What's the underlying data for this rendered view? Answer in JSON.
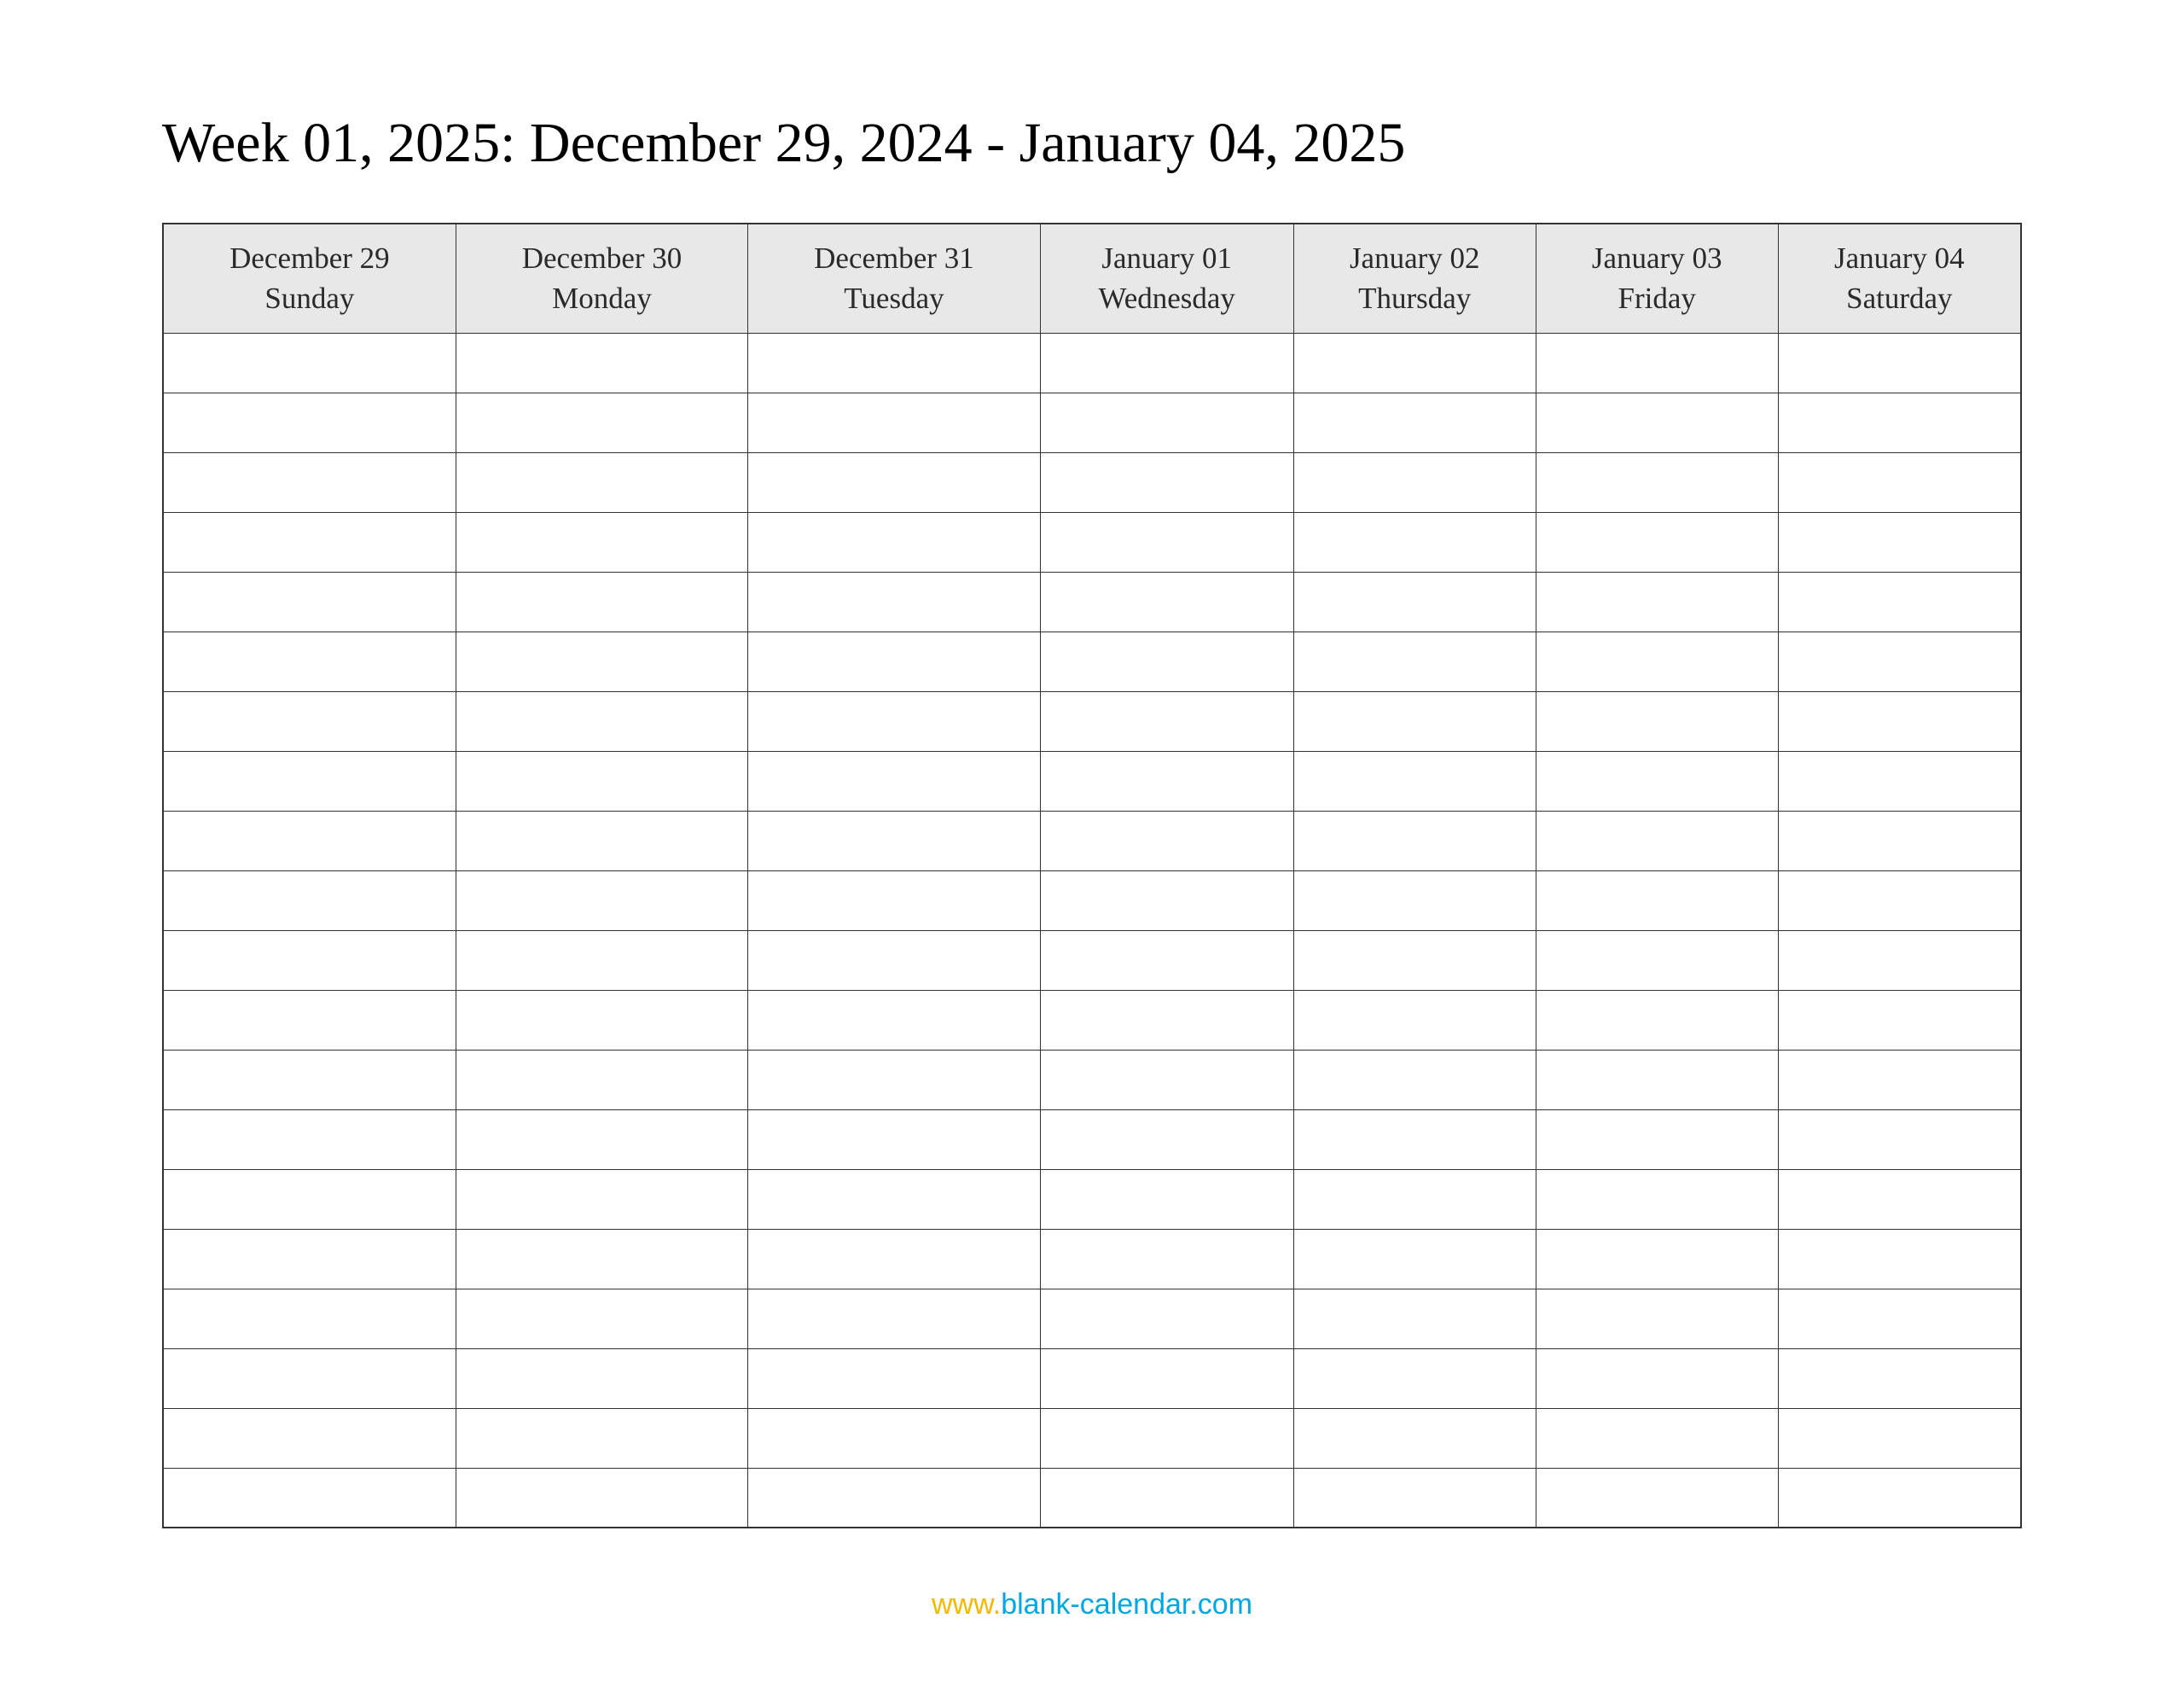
{
  "title": "Week 01, 2025: December 29, 2024 - January 04, 2025",
  "columns": [
    {
      "date": "December 29",
      "day": "Sunday"
    },
    {
      "date": "December 30",
      "day": "Monday"
    },
    {
      "date": "December 31",
      "day": "Tuesday"
    },
    {
      "date": "January 01",
      "day": "Wednesday"
    },
    {
      "date": "January 02",
      "day": "Thursday"
    },
    {
      "date": "January 03",
      "day": "Friday"
    },
    {
      "date": "January 04",
      "day": "Saturday"
    }
  ],
  "row_count": 20,
  "footer": {
    "www": "www.",
    "domain": "blank-calendar.com"
  }
}
